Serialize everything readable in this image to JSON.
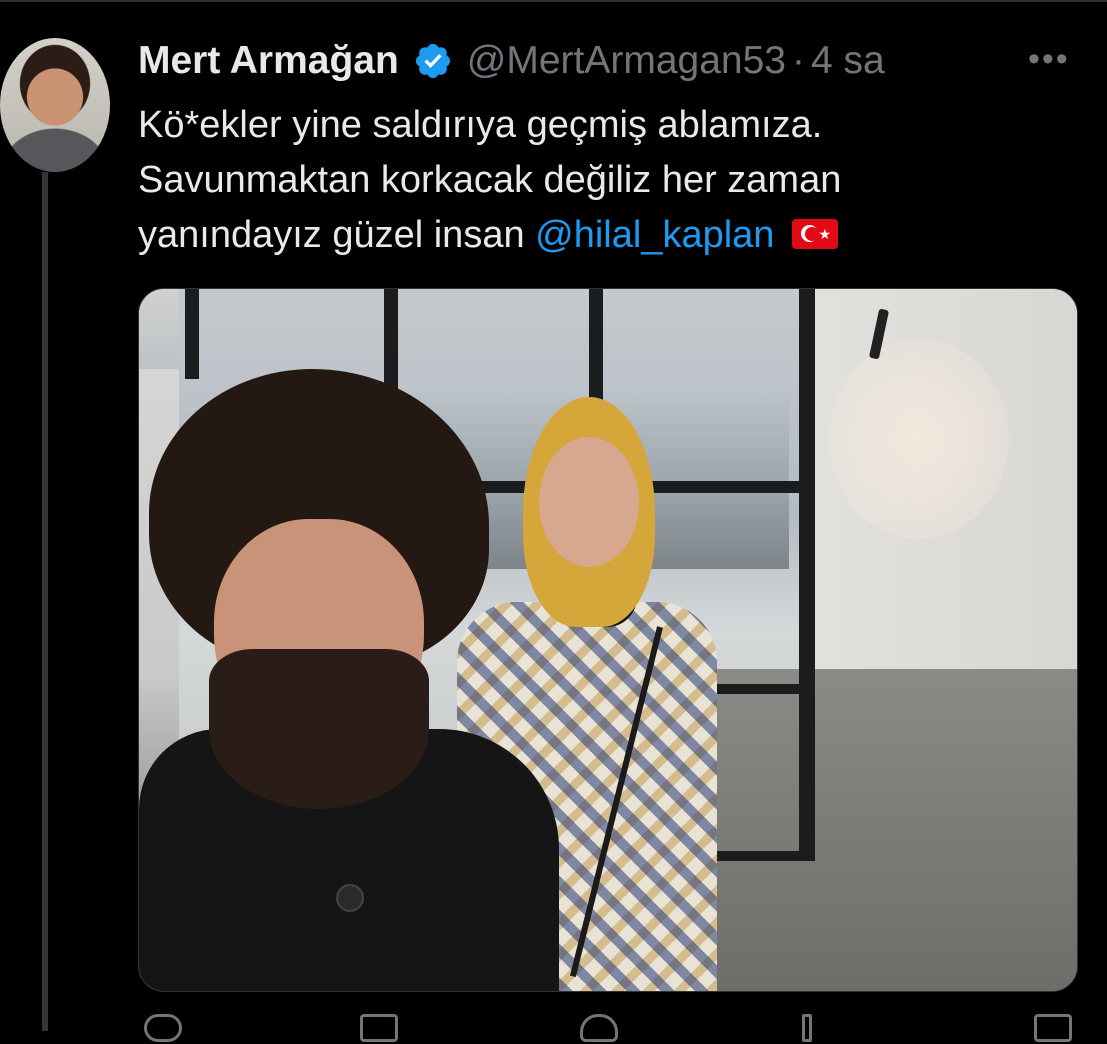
{
  "tweet": {
    "author_name": "Mert Armağan",
    "handle": "@MertArmagan53",
    "separator": "·",
    "time": "4 sa",
    "more_label": "•••",
    "text_lines": [
      "Kö*ekler yine saldırıya geçmiş ablamıza.",
      "Savunmaktan korkacak değiliz her zaman",
      "yanındayız güzel insan "
    ],
    "mention": "@hilal_kaplan",
    "flag_emoji": "turkey-flag-icon"
  },
  "colors": {
    "background": "#000000",
    "text": "#e7e9ea",
    "secondary": "#71767b",
    "accent": "#1d9bf0"
  },
  "icons": {
    "verified": "verified-badge-icon",
    "more": "more-icon",
    "reply": "reply-icon",
    "retweet": "retweet-icon",
    "like": "like-icon",
    "views": "views-icon",
    "share": "share-icon"
  }
}
